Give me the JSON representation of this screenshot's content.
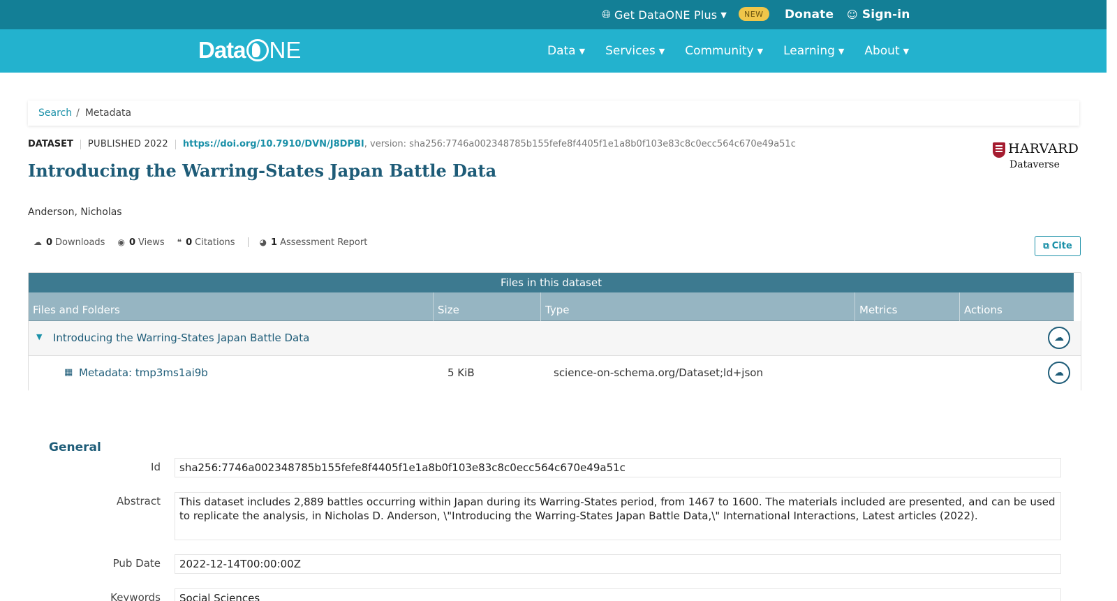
{
  "topbar": {
    "plus_label": "Get DataONE Plus",
    "new_badge": "NEW",
    "donate": "Donate",
    "signin": "Sign-in"
  },
  "logo": {
    "text_bold": "Data",
    "text_thin": "NE"
  },
  "nav": {
    "items": [
      {
        "label": "Data"
      },
      {
        "label": "Services"
      },
      {
        "label": "Community"
      },
      {
        "label": "Learning"
      },
      {
        "label": "About"
      }
    ]
  },
  "breadcrumb": {
    "search": "Search",
    "separator": "/",
    "current": "Metadata"
  },
  "dataset": {
    "type": "DATASET",
    "published": "PUBLISHED 2022",
    "doi": "https://doi.org/10.7910/DVN/J8DPBI",
    "version": ", version: sha256:7746a002348785b155fefe8f4405f1e1a8b0f103e83c8c0ecc564c670e49a51c",
    "title": "Introducing the Warring-States Japan Battle Data",
    "author": "Anderson, Nicholas"
  },
  "repository": {
    "name": "HARVARD",
    "sub": "Dataverse"
  },
  "metrics": {
    "downloads_count": "0",
    "downloads_label": "Downloads",
    "views_count": "0",
    "views_label": "Views",
    "citations_count": "0",
    "citations_label": "Citations",
    "assessment_count": "1",
    "assessment_label": "Assessment Report"
  },
  "cite_label": "Cite",
  "files": {
    "title": "Files in this dataset",
    "headers": [
      "Files and Folders",
      "Size",
      "Type",
      "Metrics",
      "Actions"
    ],
    "folder_name": "Introducing the Warring-States Japan Battle Data",
    "file": {
      "name": "Metadata: tmp3ms1ai9b",
      "size": "5 KiB",
      "type": "science-on-schema.org/Dataset;ld+json"
    }
  },
  "general": {
    "heading": "General",
    "fields": [
      {
        "label": "Id",
        "value": "sha256:7746a002348785b155fefe8f4405f1e1a8b0f103e83c8c0ecc564c670e49a51c"
      },
      {
        "label": "Abstract",
        "value": "This dataset includes 2,889 battles occurring within Japan during its Warring-States period, from 1467 to 1600. The materials included are presented, and can be used to replicate the analysis, in Nicholas D. Anderson, \\\"Introducing the Warring-States Japan Battle Data,\\\" International Interactions, Latest articles (2022)."
      },
      {
        "label": "Pub Date",
        "value": "2022-12-14T00:00:00Z"
      },
      {
        "label": "Keywords",
        "value": "Social Sciences"
      }
    ]
  },
  "colors": {
    "topbar": "#137f96",
    "navbar": "#23b2ce",
    "accent": "#1a90a8",
    "title": "#1e5c78"
  }
}
